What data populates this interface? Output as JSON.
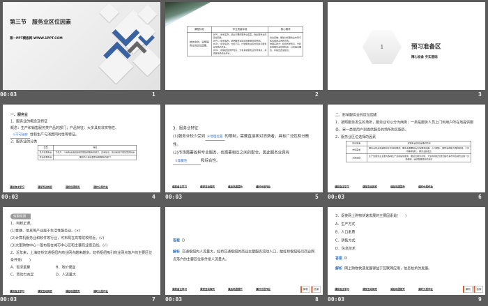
{
  "view": {
    "time": "00:03"
  },
  "slides": [
    {
      "num": "1",
      "title": "第三节　服务业区位因素",
      "website": "第一PPT模板网-WWW.1PPT.COM"
    },
    {
      "num": "2",
      "table": {
        "headers": [
          "课程标准",
          "学业质量标准",
          "核心素养"
        ],
        "col1": "结合实例，说明服务业的区位因素。",
        "col2": [
          "水平1：结合实例，说出主要的服务业类型，指出服务业的区位因素。",
          "水平2：结合实例，说明服务业区位因素变化的原因。",
          "水平3：结合实例，分析不同、比较服务业区位因素与服务业布局的关系。",
          "水平4：能够结合所学知识，分析某地服务业布局特点，并对其布局作出评价。"
        ],
        "col3": [
          "综合思维：能够分析服务业布局与区位因素之间的关系。",
          "地理实践力：结合所学知识，分析实地服务业布局特点，分析其合理性，并提出改进建议。"
        ]
      }
    },
    {
      "num": "3",
      "hex": "1",
      "title": "预习准备区",
      "subtitle": "精心准备 夯实基础"
    },
    {
      "num": "4",
      "h1": "一、服务业",
      "p1": "1．服务业的概念及特征",
      "p2a": "概念：生产和销售服务类产品的部门；产品特征：大多具有非实物性、",
      "blank1": "①不可储存",
      "p2b": "性和生产与消费同时性等特征。",
      "p3": "2．服务业的分类",
      "table": {
        "headers": [
          "类型",
          "特征"
        ],
        "rows": [
          [
            "生产性服务业",
            "为生产、②商务活动和政府管理提供服务的部门。具有信息、知识和技术密集型的特点"
          ],
          [
            "生活性服务业",
            "面向为③满足居民消费服务的部门"
          ]
        ]
      }
    },
    {
      "num": "5",
      "h": "3．服务业特征",
      "l1a": "(1)服务业较少受到",
      "b1": "④地理位置",
      "l1b": "的限制，需要直接面对消费者，具有广泛性和分散性。",
      "l2a": "(2)市场需要各种专业服务，也需要相互之间的配合，因此服务业具有",
      "b2": "⑤集聚性",
      "l2b": "和综合性。"
    },
    {
      "num": "6",
      "h": "二、影响服务业的区位因素",
      "p1": "1．按照服务发生的场所，服务业可以分为两类：一类是服务人员上门到用户所在地提供服务，另一类是用户到提供服务的场所购买服务。",
      "p2": "2．服务业区位选择的因素",
      "table": {
        "headers": [
          "区位因素",
          "对服务业区位选择的影响"
        ],
        "rows": [
          [
            "市场需求",
            "服务业的业务量取决于市场的需求，服务业需要接近市场需求旺盛、人口密集、居民消费能力强的区域，⑥市场需求越大，服务业越发达"
          ],
          [
            "交通通信",
            "生产性服务业主要为各种生产活动提供服务，要接近服务对象；大型商场和仓储式超市多布局在城市边缘⑦交通便利，经济发展较好的地方"
          ]
        ]
      }
    },
    {
      "num": "7",
      "badge": "效果检测",
      "q1": "1．判断正误。",
      "j1": "(1)金融、信息等产业属于生活性服务业。(×)",
      "j2": "(2)计算机服务业和软件等行业，可布局在高等院校附近。(√)",
      "j3": "(3)大型购物中心一般布局在城市中心区和主要商业街沿线。(√)",
      "q2": "2．近年来，上海虹桥交通枢纽内商业网点越来越多。虹桥枢纽吸引商业网点落户的主要区位条件是(　　)",
      "opts": [
        "A．需求集聚",
        "B．地价便宜",
        "C．劳动力充足",
        "D．人流量大"
      ]
    },
    {
      "num": "8",
      "ans_label": "答案",
      "ans": "D",
      "exp_label": "解析",
      "exp": "交通枢纽内人流量大，虹桥交通枢纽的商业主要服务流动人口，故虹桥枢纽吸引商业网点落户的主要区位条件是人流量大。"
    },
    {
      "num": "9",
      "q": "3．促使网上购物快速发展的主要因素是(　　)",
      "opts": [
        "A．生产方式",
        "B．人口素质",
        "C．销售方式",
        "D．信息技术"
      ],
      "ans_label": "答案",
      "ans": "D",
      "exp_label": "解析",
      "exp": "网上购物快速发展得益于互联网应用，信息技术的发展。"
    }
  ],
  "nav": [
    "课前自主学习",
    "课堂互动探究",
    "课后巩固提升",
    "课时分层作业"
  ],
  "buttons": {
    "explain": "解析",
    "answer": "答案"
  },
  "colors": {
    "background": "#5b5b5b",
    "accent_blue": "#3a62a0",
    "answer_blue": "#2a70c0"
  }
}
